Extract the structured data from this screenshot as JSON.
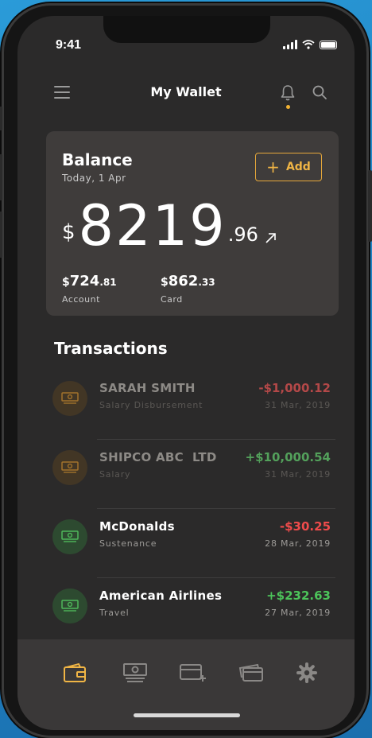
{
  "status": {
    "time": "9:41"
  },
  "header": {
    "title": "My Wallet"
  },
  "balance": {
    "title": "Balance",
    "date": "Today, 1 Apr",
    "add_label": "Add",
    "currency": "$",
    "amount_main": "8219",
    "amount_decimal": ".96",
    "accounts": [
      {
        "currency": "$",
        "whole": "724",
        "decimal": ".81",
        "label": "Account"
      },
      {
        "currency": "$",
        "whole": "862",
        "decimal": ".33",
        "label": "Card"
      }
    ]
  },
  "transactions": {
    "heading": "Transactions",
    "items": [
      {
        "name": "SARAH SMITH",
        "category": "Salary Disbursement",
        "amount": "-$1,000.12",
        "date": "31 Mar, 2019",
        "sign": "negative",
        "icon": "cash-icon",
        "icon_color": "#c98a2c"
      },
      {
        "name": "SHIPCO ABC  LTD",
        "category": "Salary",
        "amount": "+$10,000.54",
        "date": "31 Mar, 2019",
        "sign": "positive",
        "icon": "cash-icon",
        "icon_color": "#c98a2c"
      },
      {
        "name": "McDonalds",
        "category": "Sustenance",
        "amount": "-$30.25",
        "date": "28 Mar, 2019",
        "sign": "negative",
        "icon": "cash-icon",
        "icon_color": "#4fb85a"
      },
      {
        "name": "American Airlines",
        "category": "Travel",
        "amount": "+$232.63",
        "date": "27 Mar, 2019",
        "sign": "positive",
        "icon": "cash-icon",
        "icon_color": "#4fb85a"
      }
    ]
  },
  "tabs": [
    {
      "icon": "wallet-icon",
      "active": true
    },
    {
      "icon": "cash-icon",
      "active": false
    },
    {
      "icon": "add-card-icon",
      "active": false
    },
    {
      "icon": "cards-icon",
      "active": false
    },
    {
      "icon": "gear-icon",
      "active": false
    }
  ],
  "colors": {
    "accent": "#f0b545",
    "negative": "#ef4b4b",
    "positive": "#4cc45a",
    "background": "#2b2a2a",
    "card": "#3f3c3b"
  }
}
